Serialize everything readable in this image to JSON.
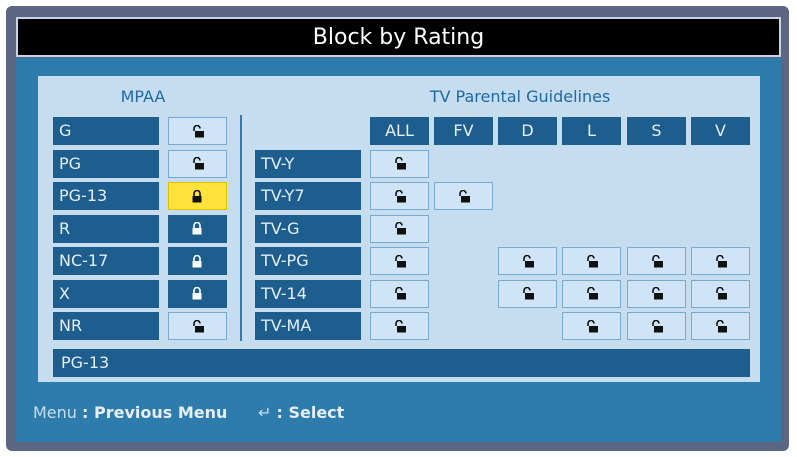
{
  "title": "Block by Rating",
  "mpaa": {
    "header": "MPAA",
    "items": [
      {
        "label": "G",
        "state": "unlocked"
      },
      {
        "label": "PG",
        "state": "unlocked"
      },
      {
        "label": "PG-13",
        "state": "locked-selected"
      },
      {
        "label": "R",
        "state": "locked"
      },
      {
        "label": "NC-17",
        "state": "locked"
      },
      {
        "label": "X",
        "state": "locked"
      },
      {
        "label": "NR",
        "state": "unlocked"
      }
    ]
  },
  "tv": {
    "header": "TV Parental Guidelines",
    "columns": [
      "ALL",
      "FV",
      "D",
      "L",
      "S",
      "V"
    ],
    "rows": [
      {
        "label": "TV-Y",
        "cells": [
          "unlocked",
          "",
          "",
          "",
          "",
          ""
        ]
      },
      {
        "label": "TV-Y7",
        "cells": [
          "unlocked",
          "unlocked",
          "",
          "",
          "",
          ""
        ]
      },
      {
        "label": "TV-G",
        "cells": [
          "unlocked",
          "",
          "",
          "",
          "",
          ""
        ]
      },
      {
        "label": "TV-PG",
        "cells": [
          "unlocked",
          "",
          "unlocked",
          "unlocked",
          "unlocked",
          "unlocked"
        ]
      },
      {
        "label": "TV-14",
        "cells": [
          "unlocked",
          "",
          "unlocked",
          "unlocked",
          "unlocked",
          "unlocked"
        ]
      },
      {
        "label": "TV-MA",
        "cells": [
          "unlocked",
          "",
          "",
          "unlocked",
          "unlocked",
          "unlocked"
        ]
      }
    ]
  },
  "status_text": "PG-13",
  "footer": {
    "menu_key": "Menu",
    "menu_action": ": Previous Menu",
    "enter_symbol": "↵",
    "enter_action": ": Select"
  },
  "colors": {
    "frame": "#5b6683",
    "panel": "#2e7cab",
    "inner": "#c5ddef",
    "label_bg": "#1d5e8e",
    "selected": "#ffe23a"
  },
  "icons": {
    "unlocked": "unlocked-padlock-icon",
    "locked": "locked-padlock-icon"
  }
}
